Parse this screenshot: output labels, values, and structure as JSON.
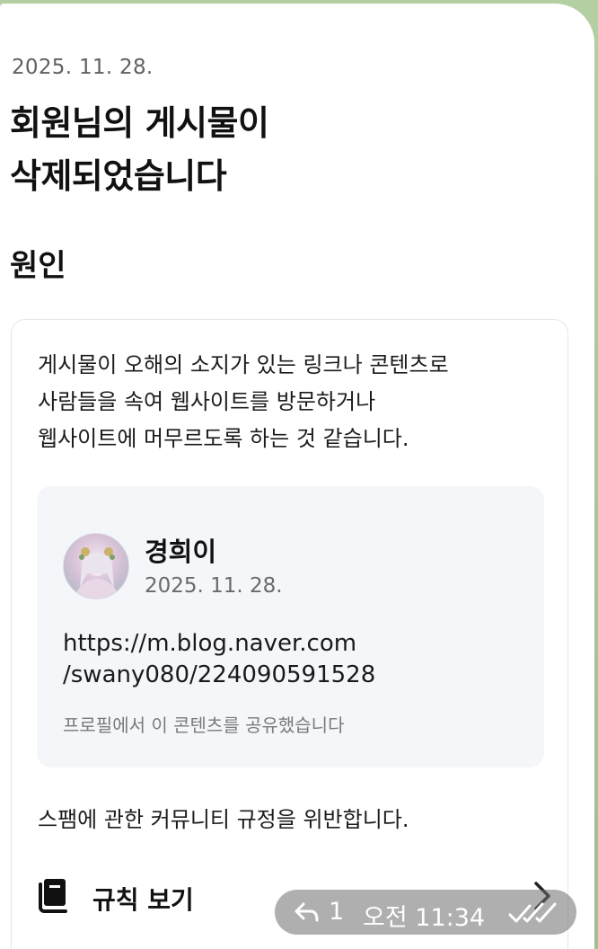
{
  "notice": {
    "date": "2025. 11. 28.",
    "title_line1": "회원님의 게시물이",
    "title_line2": "삭제되었습니다",
    "cause_heading": "원인",
    "description_line1": "게시물이 오해의 소지가 있는 링크나 콘텐츠로",
    "description_line2": "사람들을 속여 웹사이트를 방문하거나",
    "description_line3": "웹사이트에 머무르도록 하는 것 같습니다.",
    "post": {
      "author": "경희이",
      "date": "2025. 11. 28.",
      "link_line1": "https://m.blog.naver.com",
      "link_line2": "/swany080/224090591528",
      "shared_note": "프로필에서 이 콘텐츠를 공유했습니다"
    },
    "violation": "스팸에 관한 커뮤니티 규정을 위반합니다.",
    "rules_label": "규칙 보기"
  },
  "message_meta": {
    "reply_count": "1",
    "time": "오전 11:34"
  },
  "icons": {
    "book": "book-icon",
    "chevron": "chevron-right-icon",
    "reply": "reply-icon",
    "read_status": "double-check-icon"
  },
  "colors": {
    "chat_background": "#a9c79a",
    "card_border": "#e3e6ea",
    "post_box_bg": "#f4f6f9"
  }
}
